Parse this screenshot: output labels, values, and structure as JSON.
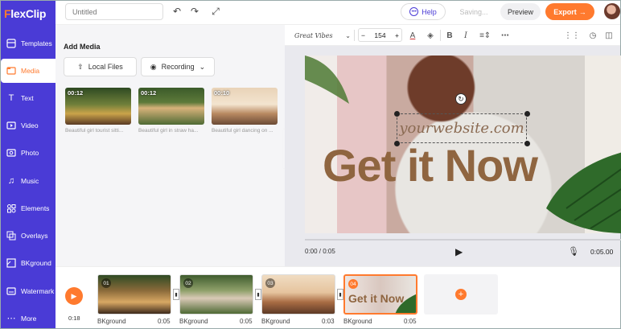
{
  "app": {
    "logo_flex": "Flex",
    "logo_clip": "Clip"
  },
  "nav": [
    {
      "label": "Templates",
      "icon": "templates-icon"
    },
    {
      "label": "Media",
      "icon": "media-icon",
      "active": true
    },
    {
      "label": "Text",
      "icon": "text-icon"
    },
    {
      "label": "Video",
      "icon": "video-icon"
    },
    {
      "label": "Photo",
      "icon": "photo-icon"
    },
    {
      "label": "Music",
      "icon": "music-icon"
    },
    {
      "label": "Elements",
      "icon": "elements-icon"
    },
    {
      "label": "Overlays",
      "icon": "overlays-icon"
    },
    {
      "label": "BKground",
      "icon": "background-icon"
    },
    {
      "label": "Watermark",
      "icon": "watermark-icon"
    },
    {
      "label": "More",
      "icon": "more-icon"
    }
  ],
  "topbar": {
    "title_placeholder": "Untitled",
    "help_label": "Help",
    "saving_label": "Saving...",
    "preview_label": "Preview",
    "export_label": "Export"
  },
  "media_panel": {
    "title": "Add Media",
    "local_files_label": "Local Files",
    "recording_label": "Recording",
    "items": [
      {
        "duration": "00:12",
        "caption": "Beautiful girl tourist sitti..."
      },
      {
        "duration": "00:12",
        "caption": "Beautiful girl in straw ha..."
      },
      {
        "duration": "00:10",
        "caption": "Beautiful girl dancing on ..."
      }
    ]
  },
  "text_toolbar": {
    "font_name": "Great Vibes",
    "font_size": "154",
    "minus": "−",
    "plus": "+"
  },
  "canvas": {
    "website_text": "yourwebsite.com",
    "headline": "Get it Now"
  },
  "player": {
    "current_time": "0:00 / 0:05",
    "total": "0:05.00"
  },
  "timeline": {
    "current": "0:18",
    "clips": [
      {
        "num": "01",
        "label": "BKground",
        "duration": "0:05"
      },
      {
        "num": "02",
        "label": "BKground",
        "duration": "0:05"
      },
      {
        "num": "03",
        "label": "BKground",
        "duration": "0:03"
      },
      {
        "num": "04",
        "label": "BKground",
        "duration": "0:05",
        "selected": true,
        "thumb_text": "Get it Now"
      }
    ]
  },
  "colors": {
    "brand": "#4a3bd6",
    "accent": "#ff7a2e"
  }
}
